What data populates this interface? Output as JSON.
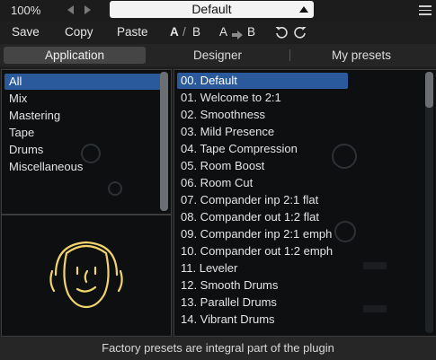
{
  "topbar": {
    "zoom": "100%",
    "preset_name": "Default"
  },
  "toolbar": {
    "save": "Save",
    "copy": "Copy",
    "paste": "Paste",
    "ab_a": "A",
    "ab_slash": "/",
    "ab_b": "B",
    "copy_a": "A",
    "copy_b": "B"
  },
  "tabs": [
    {
      "label": "Application",
      "active": true
    },
    {
      "label": "Designer",
      "active": false
    },
    {
      "label": "My presets",
      "active": false
    }
  ],
  "categories": [
    {
      "label": "All",
      "selected": true
    },
    {
      "label": "Mix",
      "selected": false
    },
    {
      "label": "Mastering",
      "selected": false
    },
    {
      "label": "Tape",
      "selected": false
    },
    {
      "label": "Drums",
      "selected": false
    },
    {
      "label": "Miscellaneous",
      "selected": false
    }
  ],
  "presets": [
    {
      "label": "00. Default",
      "selected": true
    },
    {
      "label": "01. Welcome to 2:1",
      "selected": false
    },
    {
      "label": "02. Smoothness",
      "selected": false
    },
    {
      "label": "03. Mild Presence",
      "selected": false
    },
    {
      "label": "04. Tape Compression",
      "selected": false
    },
    {
      "label": "05. Room Boost",
      "selected": false
    },
    {
      "label": "06. Room Cut",
      "selected": false
    },
    {
      "label": "07. Compander inp 2:1 flat",
      "selected": false
    },
    {
      "label": "08. Compander out 1:2 flat",
      "selected": false
    },
    {
      "label": "09. Compander inp 2:1 emph",
      "selected": false
    },
    {
      "label": "10. Compander out 1:2 emph",
      "selected": false
    },
    {
      "label": "11. Leveler",
      "selected": false
    },
    {
      "label": "12. Smooth Drums",
      "selected": false
    },
    {
      "label": "13. Parallel Drums",
      "selected": false
    },
    {
      "label": "14. Vibrant Drums",
      "selected": false
    }
  ],
  "status": "Factory presets are integral part of the plugin",
  "colors": {
    "selection": "#2a5a9c",
    "panel_bg": "#0d0f11",
    "preset_box_bg": "#f3f3f3"
  },
  "icons": [
    "arrow-left-icon",
    "arrow-right-icon",
    "dropdown-triangle-icon",
    "hamburger-menu-icon",
    "arrow-right-copy-icon",
    "undo-icon",
    "redo-icon",
    "author-face-icon"
  ]
}
